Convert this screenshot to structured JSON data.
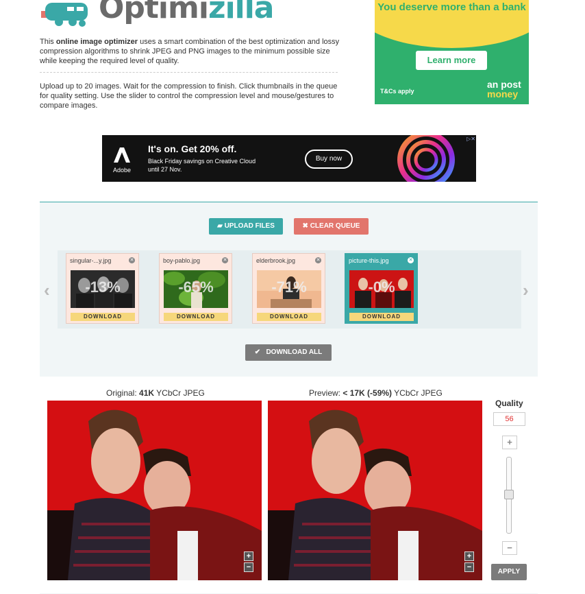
{
  "header": {
    "logo_text_a": "Optimi",
    "logo_text_b": "zilla",
    "intro_pre": "This ",
    "intro_bold": "online image optimizer",
    "intro_post": " uses a smart combination of the best optimization and lossy compression algorithms to shrink JPEG and PNG images to the minimum possible size while keeping the required level of quality.",
    "instructions": "Upload up to 20 images. Wait for the compression to finish. Click thumbnails in the queue for quality setting. Use the slider to control the compression level and mouse/gestures to compare images."
  },
  "ad_top": {
    "headline": "You deserve more than a bank",
    "button": "Learn more",
    "terms": "T&Cs apply",
    "brand_line1": "an post",
    "brand_line2": "money"
  },
  "ad_banner": {
    "brand": "Adobe",
    "title": "It's on. Get 20% off.",
    "subtitle_line1": "Black Friday savings on Creative Cloud",
    "subtitle_line2": "until 27 Nov.",
    "button": "Buy now"
  },
  "toolbar": {
    "upload_label": "UPLOAD FILES",
    "clear_label": "CLEAR QUEUE",
    "download_all_label": "DOWNLOAD ALL"
  },
  "queue": {
    "prev_arrow": "‹",
    "next_arrow": "›",
    "items": [
      {
        "name": "singular-...y.jpg",
        "savings": "-13%",
        "download": "DOWNLOAD",
        "active": false
      },
      {
        "name": "boy-pablo.jpg",
        "savings": "-65%",
        "download": "DOWNLOAD",
        "active": false
      },
      {
        "name": "elderbrook.jpg",
        "savings": "-71%",
        "download": "DOWNLOAD",
        "active": false
      },
      {
        "name": "picture-this.jpg",
        "savings": "-0%",
        "download": "DOWNLOAD",
        "active": true
      }
    ]
  },
  "compare": {
    "original_prefix": "Original: ",
    "original_size": "41K",
    "original_suffix": " YCbCr JPEG",
    "preview_prefix": "Preview: ",
    "preview_size": "< 17K (-59%)",
    "preview_suffix": " YCbCr JPEG",
    "zoom_in": "+",
    "zoom_out": "−"
  },
  "quality": {
    "label": "Quality",
    "value": "56",
    "plus": "+",
    "minus": "−",
    "apply": "APPLY"
  },
  "colors": {
    "accent": "#3aa8a7",
    "clear": "#e2756c",
    "photo_bg": "#d40f12"
  }
}
